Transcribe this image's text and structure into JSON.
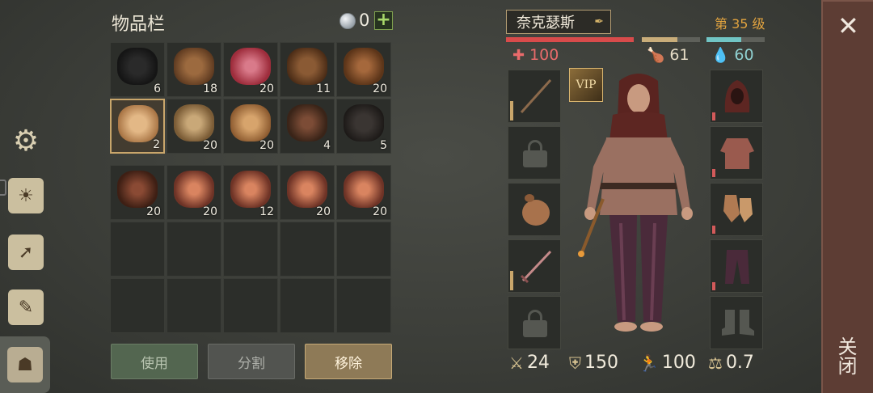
{
  "inventory": {
    "title": "物品栏",
    "gem_count": "0",
    "add_label": "+",
    "items": [
      {
        "name": "coal",
        "qty": "6"
      },
      {
        "name": "leather-hide",
        "qty": "18"
      },
      {
        "name": "raw-meat",
        "qty": "20"
      },
      {
        "name": "leather-roll",
        "qty": "11"
      },
      {
        "name": "plant-fiber",
        "qty": "20"
      },
      {
        "name": "cloth",
        "qty": "2"
      },
      {
        "name": "rope",
        "qty": "20"
      },
      {
        "name": "rags",
        "qty": "20"
      },
      {
        "name": "nails",
        "qty": "4"
      },
      {
        "name": "cord",
        "qty": "5"
      },
      {
        "name": "scrap-bundle",
        "qty": "20"
      },
      {
        "name": "copper-ore",
        "qty": "20"
      },
      {
        "name": "copper-ore",
        "qty": "12"
      },
      {
        "name": "copper-ore",
        "qty": "20"
      },
      {
        "name": "copper-ore",
        "qty": "20"
      }
    ],
    "buttons": {
      "use": "使用",
      "split": "分割",
      "remove": "移除"
    }
  },
  "character": {
    "name": "奈克瑟斯",
    "level": "第 35 级",
    "health": "100",
    "hunger": "61",
    "water": "60",
    "vip_label": "VIP",
    "stats": {
      "attack": "24",
      "armor": "150",
      "speed": "100",
      "weight": "0.7"
    }
  },
  "close_label": "关闭",
  "colors": {
    "health": "#d84b4b",
    "hunger": "#c9ad7a",
    "water": "#71c5c5",
    "level": "#e3a43f",
    "accent": "#c9a66b"
  }
}
